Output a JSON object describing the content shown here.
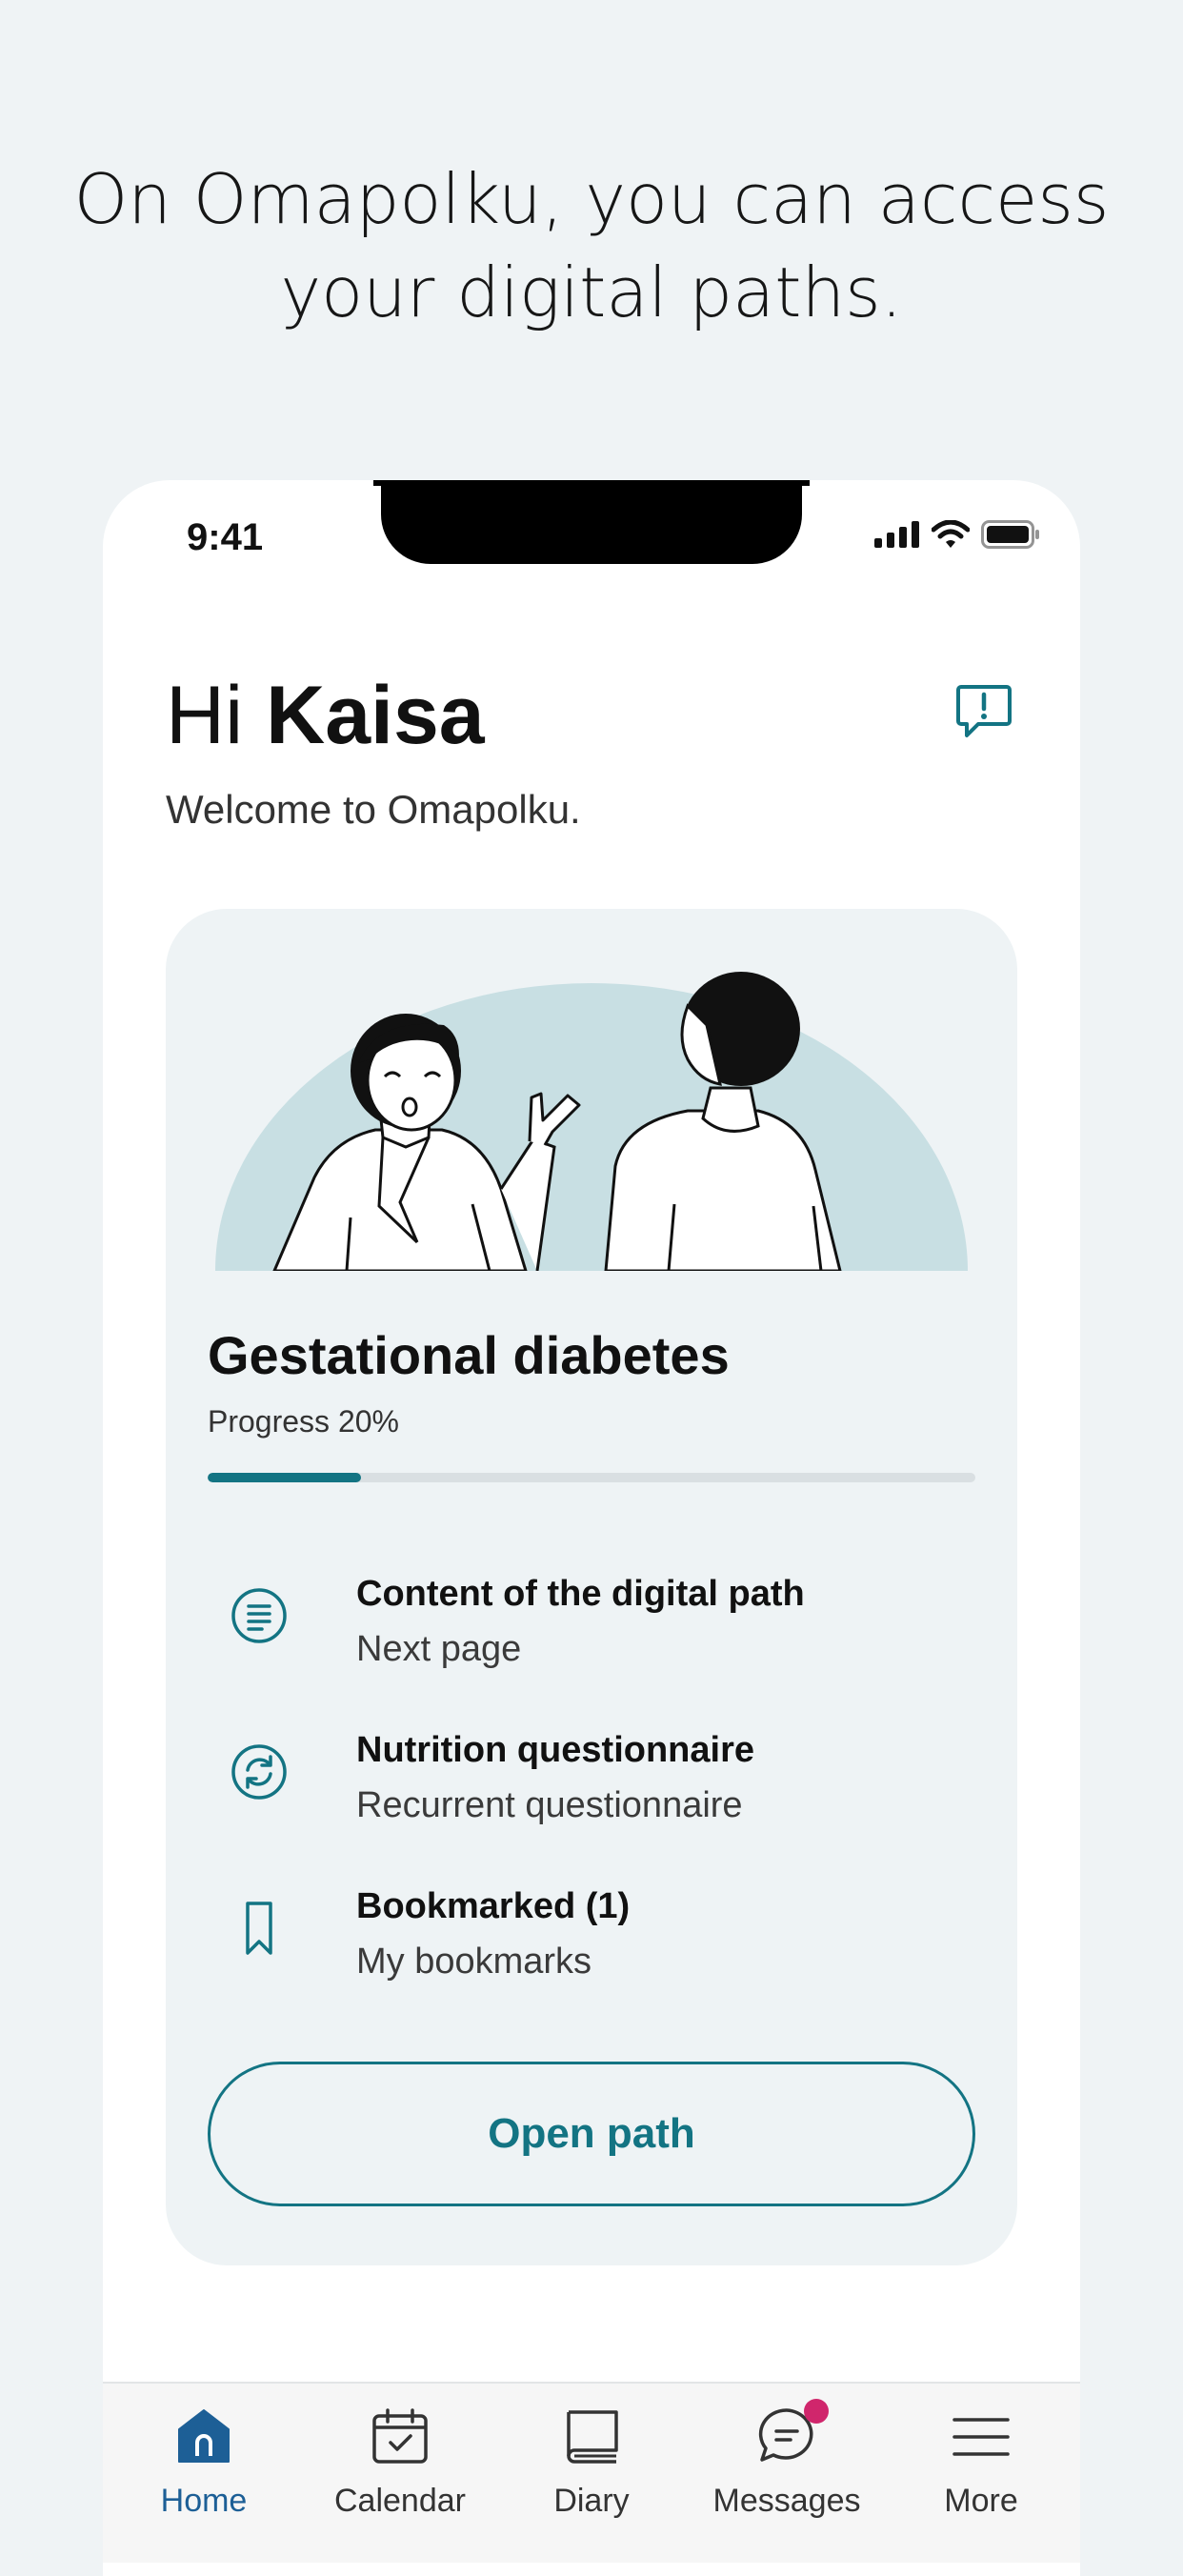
{
  "headline": [
    "On Omapolku, you can access",
    "your digital paths."
  ],
  "status_bar": {
    "time": "9:41"
  },
  "greeting": {
    "hi": "Hi",
    "name": "Kaisa",
    "welcome": "Welcome to Omapolku."
  },
  "path_card": {
    "title": "Gestational diabetes",
    "progress_label": "Progress 20%",
    "progress_value": 0.2,
    "items": [
      {
        "title": "Content of the digital path",
        "subtitle": "Next page",
        "icon": "document-lines-icon"
      },
      {
        "title": "Nutrition questionnaire",
        "subtitle": "Recurrent questionnaire",
        "icon": "refresh-circle-icon"
      },
      {
        "title": "Bookmarked (1)",
        "subtitle": "My bookmarks",
        "icon": "bookmark-icon"
      }
    ],
    "open_button": "Open path"
  },
  "tab_bar": {
    "tabs": [
      {
        "label": "Home",
        "icon": "home-icon",
        "active": true
      },
      {
        "label": "Calendar",
        "icon": "calendar-icon",
        "active": false
      },
      {
        "label": "Diary",
        "icon": "diary-book-icon",
        "active": false
      },
      {
        "label": "Messages",
        "icon": "message-bubble-icon",
        "active": false,
        "badge": true
      },
      {
        "label": "More",
        "icon": "menu-icon",
        "active": false
      }
    ]
  },
  "colors": {
    "accent": "#137483",
    "active_tab": "#1d5f96",
    "badge": "#d0266c",
    "card_bg": "#eef3f5",
    "page_bg": "#eff3f5"
  }
}
